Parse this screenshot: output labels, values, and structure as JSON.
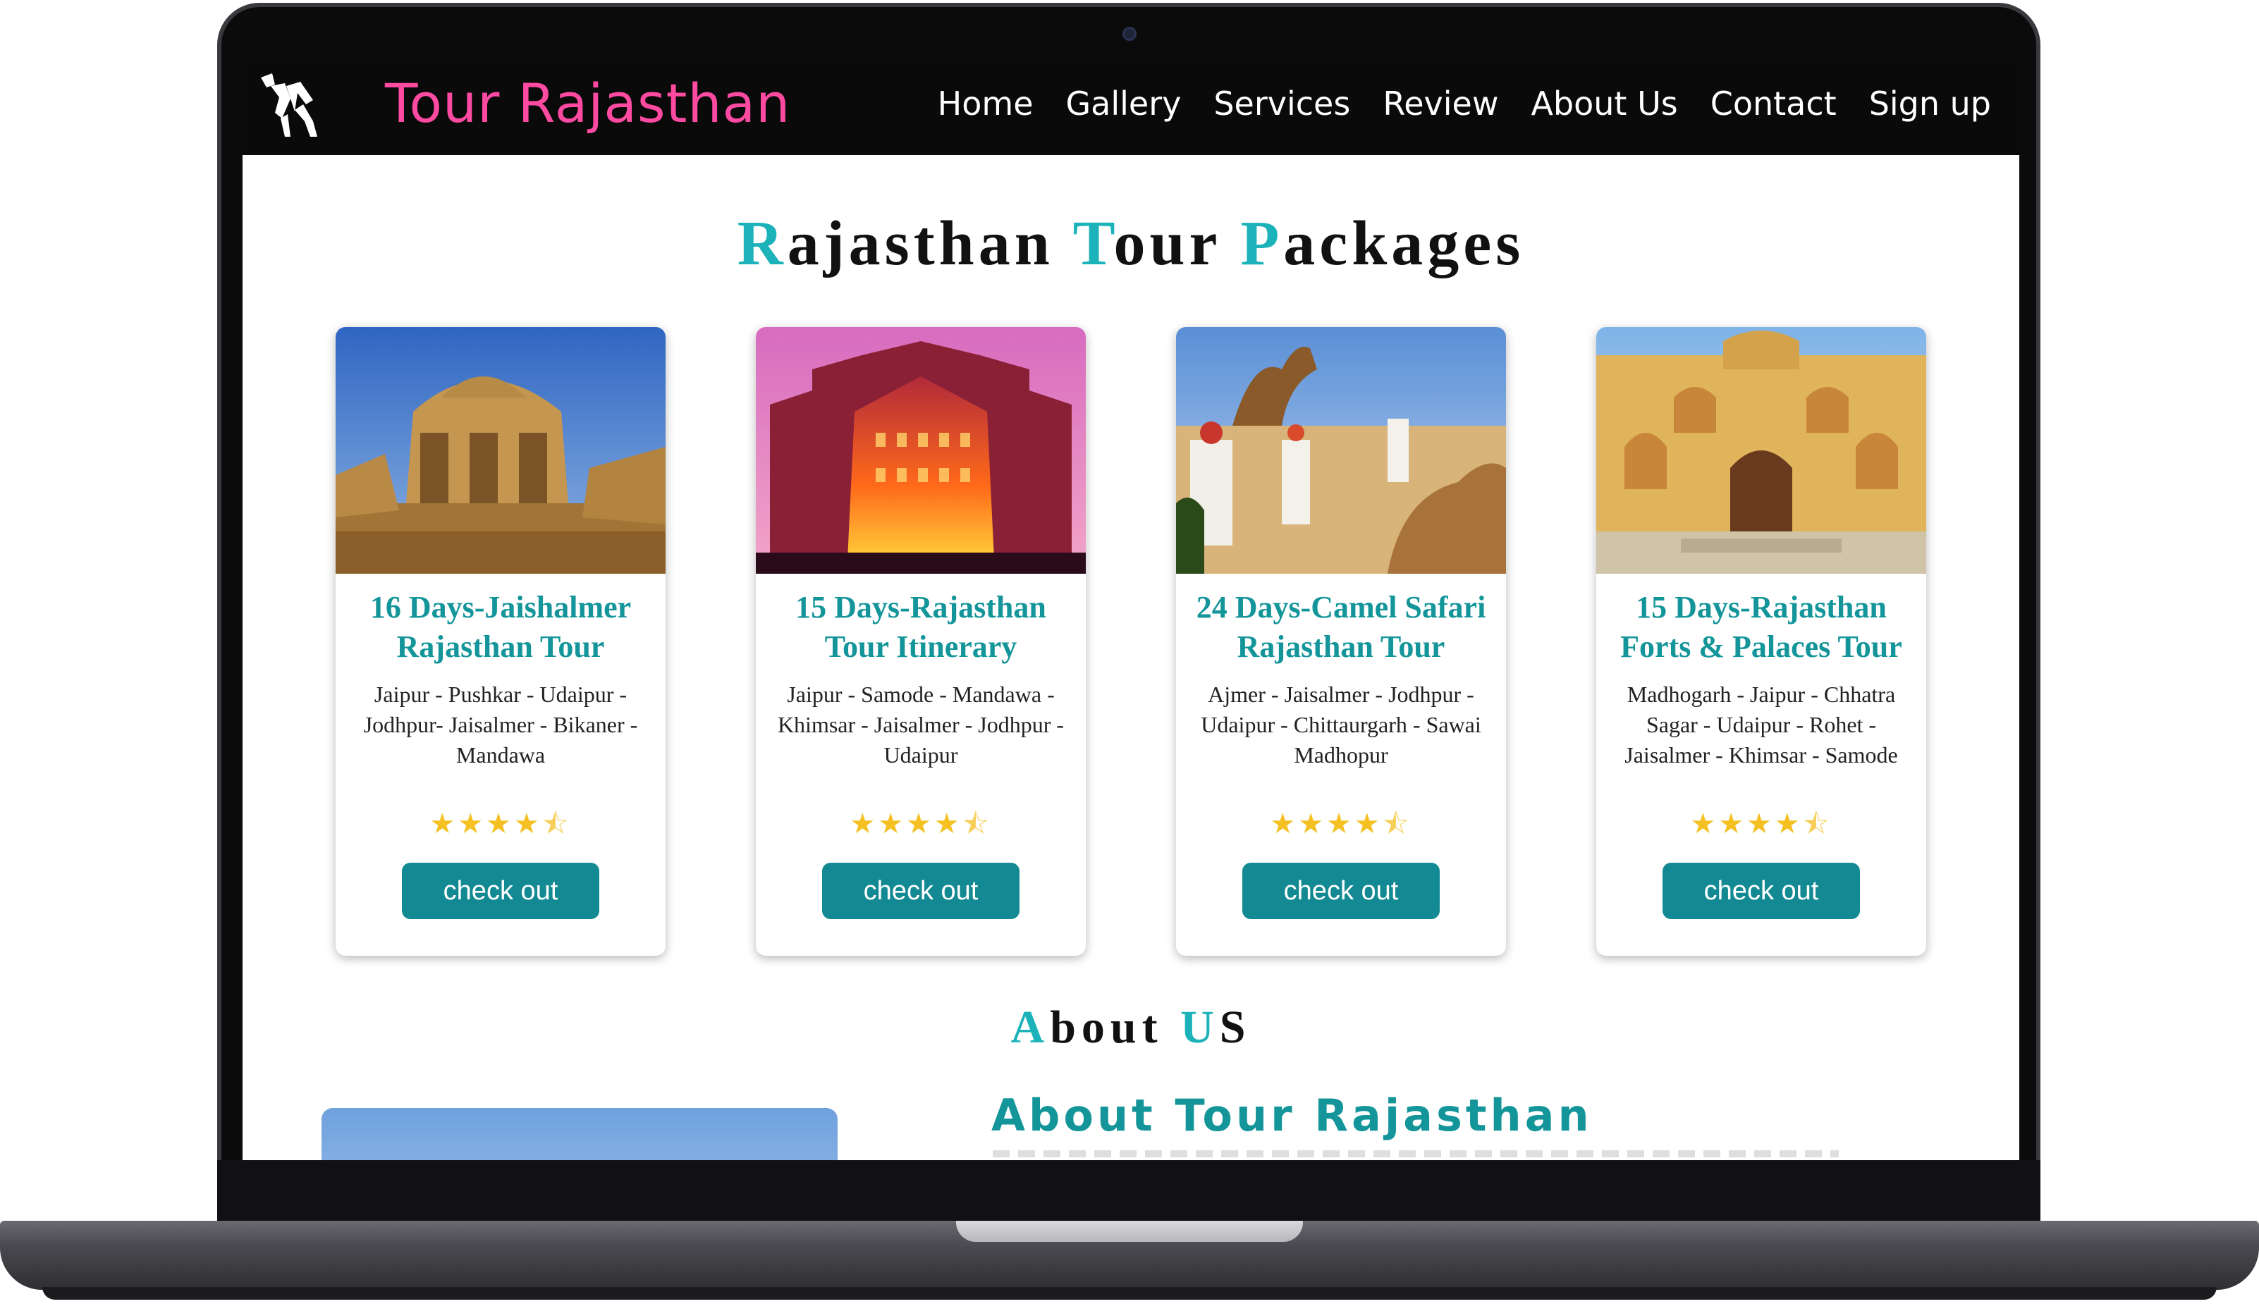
{
  "site": {
    "brand": "Tour Rajasthan",
    "logo_icon": "camel-logo-icon"
  },
  "nav": {
    "items": [
      {
        "label": "Home"
      },
      {
        "label": "Gallery"
      },
      {
        "label": "Services"
      },
      {
        "label": "Review"
      },
      {
        "label": "About Us"
      },
      {
        "label": "Contact"
      },
      {
        "label": "Sign up"
      }
    ]
  },
  "packages": {
    "title_parts": [
      {
        "accent": "R",
        "rest": "ajasthan "
      },
      {
        "accent": "T",
        "rest": "our "
      },
      {
        "accent": "P",
        "rest": "ackages"
      }
    ],
    "cards": [
      {
        "title": "16 Days-Jaishalmer Rajasthan Tour",
        "route": "Jaipur - Pushkar - Udaipur - Jodhpur- Jaisalmer - Bikaner - Mandawa",
        "rating": 4.5,
        "button": "check out",
        "image": "desert-cenotaphs-photo"
      },
      {
        "title": "15 Days-Rajasthan Tour Itinerary",
        "route": "Jaipur - Samode - Mandawa - Khimsar - Jaisalmer - Jodhpur - Udaipur",
        "rating": 4.5,
        "button": "check out",
        "image": "hawa-mahal-night-photo"
      },
      {
        "title": "24 Days-Camel Safari Rajasthan Tour",
        "route": "Ajmer - Jaisalmer - Jodhpur - Udaipur - Chittaurgarh - Sawai Madhopur",
        "rating": 4.5,
        "button": "check out",
        "image": "camel-safari-photo"
      },
      {
        "title": "15 Days-Rajasthan Forts & Palaces Tour",
        "route": "Madhogarh - Jaipur - Chhatra Sagar - Udaipur - Rohet - Jaisalmer - Khimsar - Samode",
        "rating": 4.5,
        "button": "check out",
        "image": "amber-fort-gate-photo"
      }
    ]
  },
  "about": {
    "title_parts": [
      {
        "accent": "A",
        "rest": "bout "
      },
      {
        "accent": "U",
        "rest": "S"
      }
    ],
    "heading": "About Tour Rajasthan"
  },
  "colors": {
    "brand": "#ff4aa2",
    "accent": "#1bb3b9",
    "card_title": "#13959a",
    "button": "#138a93",
    "star": "#f5c021"
  }
}
